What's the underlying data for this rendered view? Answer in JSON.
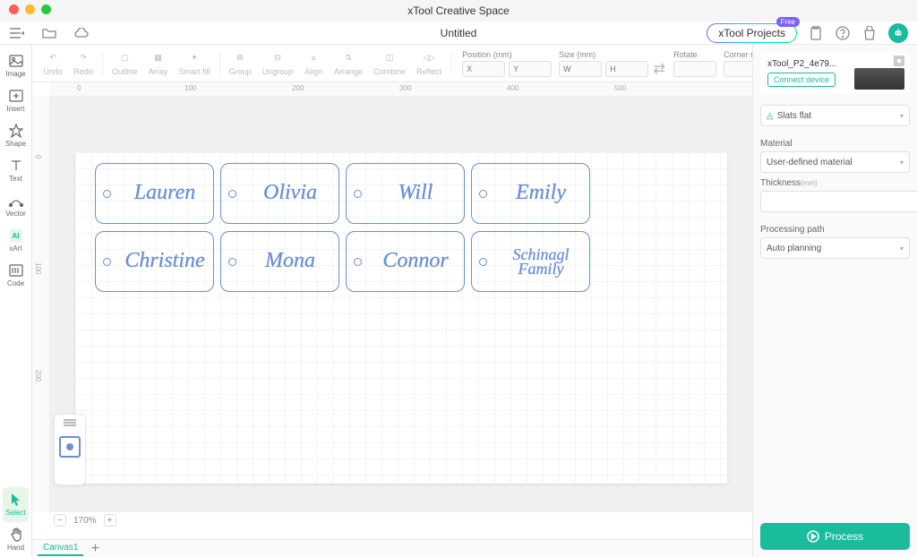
{
  "app": {
    "title": "xTool Creative Space"
  },
  "document": {
    "name": "Untitled"
  },
  "projects_button": {
    "label": "xTool Projects",
    "badge": "Free"
  },
  "toolbar": {
    "undo": "Undo",
    "redo": "Redo",
    "outline": "Outline",
    "array": "Array",
    "smartfill": "Smart fill",
    "group": "Group",
    "ungroup": "Ungroup",
    "align": "Align",
    "arrange": "Arrange",
    "combine": "Combine",
    "reflect": "Reflect"
  },
  "properties": {
    "position": {
      "label": "Position (mm)",
      "x_ph": "X",
      "y_ph": "Y"
    },
    "size": {
      "label": "Size (mm)",
      "w_ph": "W",
      "h_ph": "H"
    },
    "rotate": {
      "label": "Rotate"
    },
    "corner": {
      "label": "Corner radius (mm)"
    }
  },
  "left_tools": {
    "image": "Image",
    "insert": "Insert",
    "shape": "Shape",
    "text": "Text",
    "vector": "Vector",
    "xart": "xArt",
    "xart_badge": "AI",
    "code": "Code",
    "select": "Select",
    "hand": "Hand"
  },
  "canvas_tags": {
    "row1": [
      "Lauren",
      "Olivia",
      "Will",
      "Emily"
    ],
    "row2": [
      "Christine",
      "Mona",
      "Connor",
      "Schinagl\nFamily"
    ]
  },
  "ruler_h": [
    "0",
    "100",
    "200",
    "300",
    "400",
    "500"
  ],
  "ruler_v": [
    "0",
    "100",
    "200"
  ],
  "zoom": {
    "level": "170%"
  },
  "tabs": {
    "canvas1": "Canvas1"
  },
  "device": {
    "name": "xTool_P2_4e79...",
    "connect": "Connect device",
    "bed_type": "Slats flat"
  },
  "material": {
    "label": "Material",
    "value": "User-defined material",
    "thickness_label": "Thickness",
    "thickness_unit": "(mm)"
  },
  "processing": {
    "label": "Processing path",
    "value": "Auto planning"
  },
  "process_button": "Process"
}
